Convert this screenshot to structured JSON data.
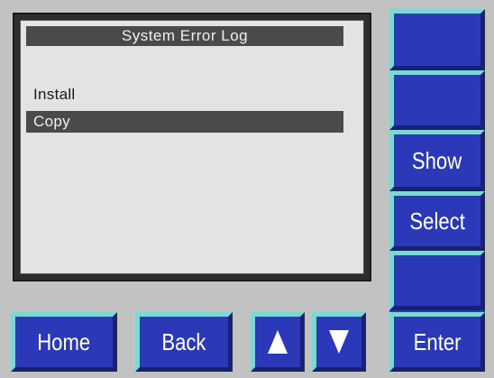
{
  "screen": {
    "title": "System Error Log",
    "menu_items": [
      {
        "label": "Install",
        "selected": false
      },
      {
        "label": "Copy",
        "selected": true
      }
    ]
  },
  "side_buttons": [
    {
      "label": ""
    },
    {
      "label": ""
    },
    {
      "label": "Show"
    },
    {
      "label": "Select"
    },
    {
      "label": ""
    },
    {
      "label": "Enter"
    }
  ],
  "bottom_buttons": {
    "home": "Home",
    "back": "Back",
    "up_icon": "arrow-up-icon",
    "down_icon": "arrow-down-icon"
  },
  "colors": {
    "button_blue": "#2b39b8",
    "button_highlight": "#7fd6d6",
    "selection": "#4a4a4a",
    "panel": "#c2c2c2"
  }
}
